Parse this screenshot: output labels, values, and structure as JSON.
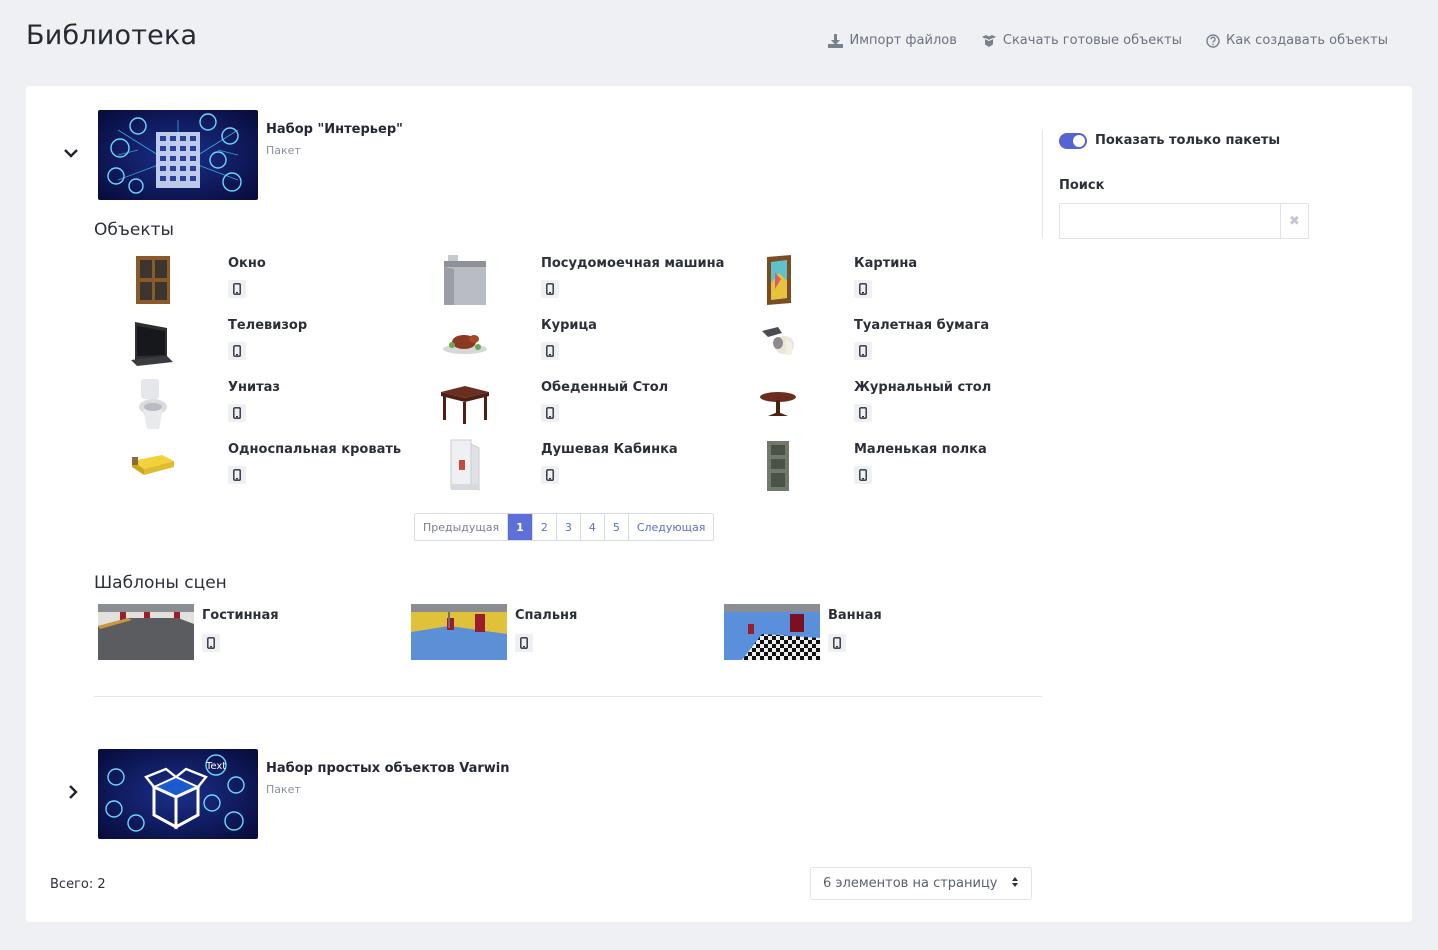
{
  "header": {
    "title": "Библиотека",
    "actions": [
      {
        "label": "Импорт файлов",
        "icon": "download-icon"
      },
      {
        "label": "Скачать готовые объекты",
        "icon": "boxes-icon"
      },
      {
        "label": "Как создавать объекты",
        "icon": "help-circle-icon"
      }
    ]
  },
  "packages": [
    {
      "title": "Набор \"Интерьер\"",
      "subtitle": "Пакет",
      "expanded": true,
      "thumb_icon": "building-network-thumbnail"
    },
    {
      "title": "Набор простых объектов Varwin",
      "subtitle": "Пакет",
      "expanded": false,
      "thumb_icon": "box-network-thumbnail"
    }
  ],
  "objects_section": {
    "title": "Объекты",
    "items": [
      {
        "name": "Окно",
        "icon": "window-thumbnail"
      },
      {
        "name": "Посудомоечная машина",
        "icon": "dishwasher-thumbnail"
      },
      {
        "name": "Картина",
        "icon": "painting-thumbnail"
      },
      {
        "name": "Телевизор",
        "icon": "tv-thumbnail"
      },
      {
        "name": "Курица",
        "icon": "chicken-thumbnail"
      },
      {
        "name": "Туалетная бумага",
        "icon": "toilet-paper-thumbnail"
      },
      {
        "name": "Унитаз",
        "icon": "toilet-thumbnail"
      },
      {
        "name": "Обеденный Стол",
        "icon": "dining-table-thumbnail"
      },
      {
        "name": "Журнальный стол",
        "icon": "coffee-table-thumbnail"
      },
      {
        "name": "Односпальная кровать",
        "icon": "bed-thumbnail"
      },
      {
        "name": "Душевая Кабинка",
        "icon": "shower-thumbnail"
      },
      {
        "name": "Маленькая полка",
        "icon": "shelf-thumbnail"
      }
    ],
    "pagination": {
      "prev_label": "Предыдущая",
      "pages": [
        "1",
        "2",
        "3",
        "4",
        "5"
      ],
      "active_page": "1",
      "next_label": "Следующая"
    }
  },
  "scenes_section": {
    "title": "Шаблоны сцен",
    "items": [
      {
        "name": "Гостинная",
        "icon": "living-room-thumbnail"
      },
      {
        "name": "Спальня",
        "icon": "bedroom-thumbnail"
      },
      {
        "name": "Ванная",
        "icon": "bathroom-thumbnail"
      }
    ]
  },
  "sidebar": {
    "toggle_label": "Показать только пакеты",
    "toggle_on": true,
    "search_label": "Поиск",
    "search_value": "",
    "search_placeholder": ""
  },
  "footer": {
    "total_label": "Всего: 2",
    "per_page_value": "6 элементов на страницу"
  },
  "colors": {
    "accent": "#5664d2",
    "background": "#eef0f4"
  }
}
